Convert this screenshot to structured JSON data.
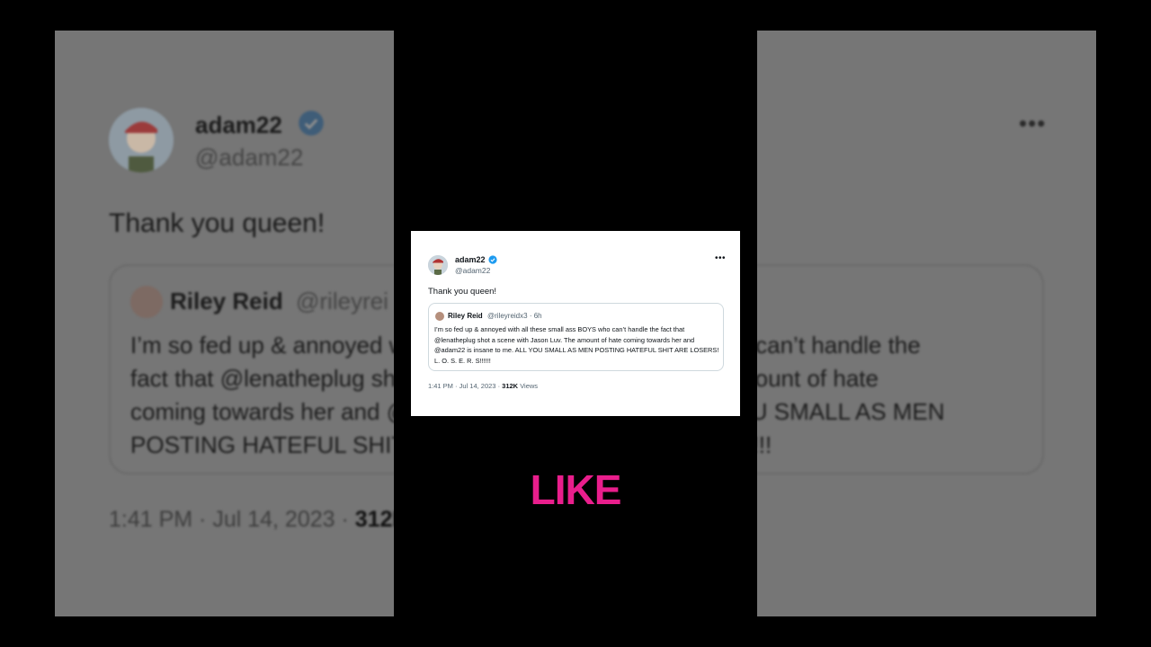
{
  "tweet": {
    "display_name": "adam22",
    "handle": "@adam22",
    "text": "Thank you queen!",
    "time": "1:41 PM",
    "date_sep": " · ",
    "date": "Jul 14, 2023",
    "views_count": "312K",
    "views_label": "Views",
    "more": "•••"
  },
  "quoted": {
    "display_name": "Riley Reid",
    "handle": "@rileyreidx3",
    "age": "· 6h",
    "text": "I’m so fed up & annoyed with all these small ass BOYS who can’t handle the fact that @lenatheplug shot a scene with Jason Luv. The amount of hate coming towards her and @adam22 is insane to me. ALL YOU SMALL AS MEN POSTING HATEFUL SHIT ARE LOSERS! L. O. S. E. R. S!!!!!!"
  },
  "background": {
    "display_name": "adam22",
    "handle": "@adam22",
    "text": "Thank you queen!",
    "quoted_name": "Riley Reid",
    "quoted_handle_partial": "@rileyrei",
    "quoted_lines": [
      "I’m so fed up & annoyed with all these small ass BOYS who can’t handle the",
      "fact that @lenatheplug shot a scene with Jason Luv. The amount of hate",
      "coming towards her and @adam22 is insane to me. ALL YOU SMALL AS MEN",
      "POSTING HATEFUL SHIT ARE LOSERS! L. O. S. E. R. S!!!!!!"
    ],
    "meta": "1:41 PM · Jul 14, 2023 · ",
    "meta_views_partial": "312K"
  },
  "overlay": {
    "word": "LIKE",
    "color": "#e91e8c"
  },
  "colors": {
    "verified": "#1d9bf0",
    "text_primary": "#0f1419",
    "text_secondary": "#536471",
    "border": "#cfd9de"
  }
}
